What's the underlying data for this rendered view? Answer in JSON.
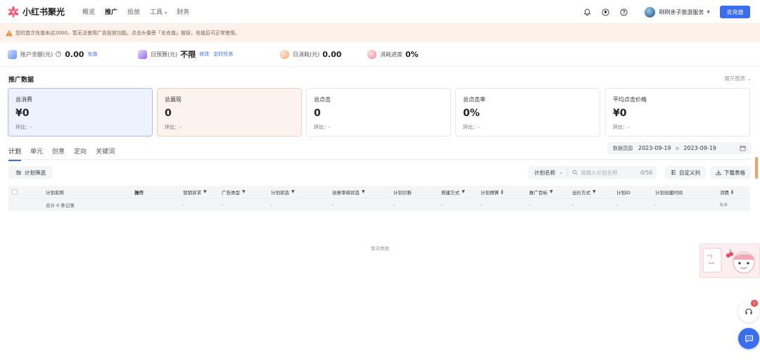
{
  "brand": {
    "name": "小红书聚光"
  },
  "nav": {
    "items": [
      {
        "label": "概览"
      },
      {
        "label": "推广"
      },
      {
        "label": "投放"
      },
      {
        "label": "工具"
      },
      {
        "label": "财务"
      }
    ],
    "active_index": 1,
    "user_name": "咧咧亲子旅游服务",
    "recharge_label": "去充值"
  },
  "banner": {
    "text": "您的首次充值未达2000，暂无法使用广告投放功能。点击头像旁「去充值」按钮，充值后可正常使用。"
  },
  "stats": {
    "balance": {
      "label": "账户余额(元)",
      "value": "0.00",
      "link": "充值"
    },
    "budget": {
      "label": "日预算(元)",
      "value": "不限",
      "link1": "修改",
      "link2": "定时任务"
    },
    "daily_spend": {
      "label": "日消耗(元)",
      "value": "0.00"
    },
    "progress": {
      "label": "消耗进度",
      "value": "0%"
    }
  },
  "section": {
    "title": "推广数据",
    "expand_label": "展开图表"
  },
  "cards": [
    {
      "label": "总消费",
      "value": "¥0",
      "compare": "环比：-"
    },
    {
      "label": "总展现",
      "value": "0",
      "compare": "环比：-"
    },
    {
      "label": "总点击",
      "value": "0",
      "compare": "环比：-"
    },
    {
      "label": "总点击率",
      "value": "0%",
      "compare": "环比：-"
    },
    {
      "label": "平均点击价格",
      "value": "¥0",
      "compare": "环比：-"
    }
  ],
  "tabs": [
    {
      "label": "计划"
    },
    {
      "label": "单元"
    },
    {
      "label": "创意"
    },
    {
      "label": "定向"
    },
    {
      "label": "关键词"
    }
  ],
  "date_range": {
    "label": "数据范围",
    "start": "2023-09-19",
    "end": "2023-09-19",
    "separator": "≡"
  },
  "toolbar": {
    "filter_label": "计划筛选",
    "search_type": "计划名称",
    "search_placeholder": "请输入计划名称",
    "search_count": "0/50",
    "customize_label": "自定义列",
    "download_label": "下载表格"
  },
  "table": {
    "columns": [
      "计划名称",
      "操作",
      "营销诉求",
      "广告类型",
      "计划状态",
      "创意审核状态",
      "计划诊断",
      "搭建方式",
      "计划预算",
      "推广目标",
      "出价方式",
      "计划ID",
      "计划创建时间",
      "消费"
    ],
    "total_row": {
      "name": "合计 0 条记录",
      "values": [
        "-",
        "-",
        "-",
        "-",
        "-",
        "-",
        "-",
        "-",
        "-",
        "-",
        "-",
        "0.0"
      ]
    },
    "empty_text": "暂无数据"
  },
  "support": {
    "badge": "0"
  },
  "colors": {
    "primary": "#3b6df0",
    "warning": "#f07b2e",
    "banner_bg": "#fdf2ea"
  }
}
